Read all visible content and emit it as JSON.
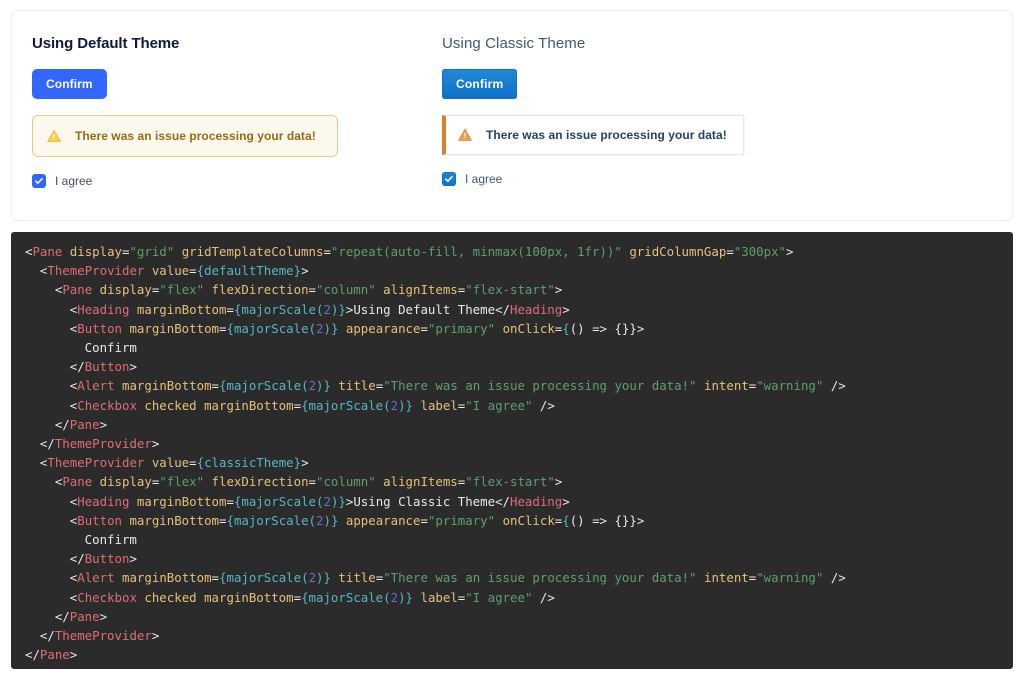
{
  "preview": {
    "columns": [
      {
        "theme_key": "default",
        "heading": "Using Default Theme",
        "button_label": "Confirm",
        "alert": {
          "title": "There was an issue processing your data!",
          "intent": "warning",
          "icon": "warning-triangle-icon"
        },
        "checkbox": {
          "label": "I agree",
          "checked": true
        }
      },
      {
        "theme_key": "classic",
        "heading": "Using Classic Theme",
        "button_label": "Confirm",
        "alert": {
          "title": "There was an issue processing your data!",
          "intent": "warning",
          "icon": "warning-triangle-icon"
        },
        "checkbox": {
          "label": "I agree",
          "checked": true
        }
      }
    ]
  },
  "colors": {
    "default_primary": "#3366FF",
    "classic_primary": "#1070CA",
    "warning_default_border": "#EBC884",
    "warning_default_bg": "#FDF8EE",
    "warning_default_text": "#996A13",
    "warning_classic_bar": "#D9822B",
    "warning_classic_text": "#234361",
    "code_background": "#2B2B2B",
    "panel_border": "#EDEFF5"
  },
  "code": {
    "language": "jsx",
    "lines": [
      [
        {
          "t": "punct",
          "v": "<"
        },
        {
          "t": "tag",
          "v": "Pane"
        },
        {
          "t": "text",
          "v": " "
        },
        {
          "t": "attr",
          "v": "display"
        },
        {
          "t": "punct",
          "v": "="
        },
        {
          "t": "string",
          "v": "\"grid\""
        },
        {
          "t": "text",
          "v": " "
        },
        {
          "t": "attr",
          "v": "gridTemplateColumns"
        },
        {
          "t": "punct",
          "v": "="
        },
        {
          "t": "string",
          "v": "\"repeat(auto-fill, minmax(100px, 1fr))\""
        },
        {
          "t": "text",
          "v": " "
        },
        {
          "t": "attr",
          "v": "gridColumnGap"
        },
        {
          "t": "punct",
          "v": "="
        },
        {
          "t": "string",
          "v": "\"300px\""
        },
        {
          "t": "punct",
          "v": ">"
        }
      ],
      [
        {
          "t": "text",
          "v": "  "
        },
        {
          "t": "punct",
          "v": "<"
        },
        {
          "t": "tag",
          "v": "ThemeProvider"
        },
        {
          "t": "text",
          "v": " "
        },
        {
          "t": "attr",
          "v": "value"
        },
        {
          "t": "punct",
          "v": "="
        },
        {
          "t": "brace",
          "v": "{"
        },
        {
          "t": "fn",
          "v": "defaultTheme"
        },
        {
          "t": "brace",
          "v": "}"
        },
        {
          "t": "punct",
          "v": ">"
        }
      ],
      [
        {
          "t": "text",
          "v": "    "
        },
        {
          "t": "punct",
          "v": "<"
        },
        {
          "t": "tag",
          "v": "Pane"
        },
        {
          "t": "text",
          "v": " "
        },
        {
          "t": "attr",
          "v": "display"
        },
        {
          "t": "punct",
          "v": "="
        },
        {
          "t": "string",
          "v": "\"flex\""
        },
        {
          "t": "text",
          "v": " "
        },
        {
          "t": "attr",
          "v": "flexDirection"
        },
        {
          "t": "punct",
          "v": "="
        },
        {
          "t": "string",
          "v": "\"column\""
        },
        {
          "t": "text",
          "v": " "
        },
        {
          "t": "attr",
          "v": "alignItems"
        },
        {
          "t": "punct",
          "v": "="
        },
        {
          "t": "string",
          "v": "\"flex-start\""
        },
        {
          "t": "punct",
          "v": ">"
        }
      ],
      [
        {
          "t": "text",
          "v": "      "
        },
        {
          "t": "punct",
          "v": "<"
        },
        {
          "t": "tag",
          "v": "Heading"
        },
        {
          "t": "text",
          "v": " "
        },
        {
          "t": "attr",
          "v": "marginBottom"
        },
        {
          "t": "punct",
          "v": "="
        },
        {
          "t": "brace",
          "v": "{"
        },
        {
          "t": "fn",
          "v": "majorScale"
        },
        {
          "t": "brace",
          "v": "("
        },
        {
          "t": "num",
          "v": "2"
        },
        {
          "t": "brace",
          "v": ")}"
        },
        {
          "t": "punct",
          "v": ">"
        },
        {
          "t": "text",
          "v": "Using Default Theme"
        },
        {
          "t": "punct",
          "v": "</"
        },
        {
          "t": "tag",
          "v": "Heading"
        },
        {
          "t": "punct",
          "v": ">"
        }
      ],
      [
        {
          "t": "text",
          "v": "      "
        },
        {
          "t": "punct",
          "v": "<"
        },
        {
          "t": "tag",
          "v": "Button"
        },
        {
          "t": "text",
          "v": " "
        },
        {
          "t": "attr",
          "v": "marginBottom"
        },
        {
          "t": "punct",
          "v": "="
        },
        {
          "t": "brace",
          "v": "{"
        },
        {
          "t": "fn",
          "v": "majorScale"
        },
        {
          "t": "brace",
          "v": "("
        },
        {
          "t": "num",
          "v": "2"
        },
        {
          "t": "brace",
          "v": ")}"
        },
        {
          "t": "text",
          "v": " "
        },
        {
          "t": "attr",
          "v": "appearance"
        },
        {
          "t": "punct",
          "v": "="
        },
        {
          "t": "string",
          "v": "\"primary\""
        },
        {
          "t": "text",
          "v": " "
        },
        {
          "t": "attr",
          "v": "onClick"
        },
        {
          "t": "punct",
          "v": "="
        },
        {
          "t": "brace",
          "v": "{"
        },
        {
          "t": "punct",
          "v": "() => {}}"
        },
        {
          "t": "punct",
          "v": ">"
        }
      ],
      [
        {
          "t": "text",
          "v": "        Confirm"
        }
      ],
      [
        {
          "t": "text",
          "v": "      "
        },
        {
          "t": "punct",
          "v": "</"
        },
        {
          "t": "tag",
          "v": "Button"
        },
        {
          "t": "punct",
          "v": ">"
        }
      ],
      [
        {
          "t": "text",
          "v": "      "
        },
        {
          "t": "punct",
          "v": "<"
        },
        {
          "t": "tag",
          "v": "Alert"
        },
        {
          "t": "text",
          "v": " "
        },
        {
          "t": "attr",
          "v": "marginBottom"
        },
        {
          "t": "punct",
          "v": "="
        },
        {
          "t": "brace",
          "v": "{"
        },
        {
          "t": "fn",
          "v": "majorScale"
        },
        {
          "t": "brace",
          "v": "("
        },
        {
          "t": "num",
          "v": "2"
        },
        {
          "t": "brace",
          "v": ")}"
        },
        {
          "t": "text",
          "v": " "
        },
        {
          "t": "attr",
          "v": "title"
        },
        {
          "t": "punct",
          "v": "="
        },
        {
          "t": "string",
          "v": "\"There was an issue processing your data!\""
        },
        {
          "t": "text",
          "v": " "
        },
        {
          "t": "attr",
          "v": "intent"
        },
        {
          "t": "punct",
          "v": "="
        },
        {
          "t": "string",
          "v": "\"warning\""
        },
        {
          "t": "text",
          "v": " "
        },
        {
          "t": "punct",
          "v": "/>"
        }
      ],
      [
        {
          "t": "text",
          "v": "      "
        },
        {
          "t": "punct",
          "v": "<"
        },
        {
          "t": "tag",
          "v": "Checkbox"
        },
        {
          "t": "text",
          "v": " "
        },
        {
          "t": "attr",
          "v": "checked"
        },
        {
          "t": "text",
          "v": " "
        },
        {
          "t": "attr",
          "v": "marginBottom"
        },
        {
          "t": "punct",
          "v": "="
        },
        {
          "t": "brace",
          "v": "{"
        },
        {
          "t": "fn",
          "v": "majorScale"
        },
        {
          "t": "brace",
          "v": "("
        },
        {
          "t": "num",
          "v": "2"
        },
        {
          "t": "brace",
          "v": ")}"
        },
        {
          "t": "text",
          "v": " "
        },
        {
          "t": "attr",
          "v": "label"
        },
        {
          "t": "punct",
          "v": "="
        },
        {
          "t": "string",
          "v": "\"I agree\""
        },
        {
          "t": "text",
          "v": " "
        },
        {
          "t": "punct",
          "v": "/>"
        }
      ],
      [
        {
          "t": "text",
          "v": "    "
        },
        {
          "t": "punct",
          "v": "</"
        },
        {
          "t": "tag",
          "v": "Pane"
        },
        {
          "t": "punct",
          "v": ">"
        }
      ],
      [
        {
          "t": "text",
          "v": "  "
        },
        {
          "t": "punct",
          "v": "</"
        },
        {
          "t": "tag",
          "v": "ThemeProvider"
        },
        {
          "t": "punct",
          "v": ">"
        }
      ],
      [
        {
          "t": "text",
          "v": "  "
        },
        {
          "t": "punct",
          "v": "<"
        },
        {
          "t": "tag",
          "v": "ThemeProvider"
        },
        {
          "t": "text",
          "v": " "
        },
        {
          "t": "attr",
          "v": "value"
        },
        {
          "t": "punct",
          "v": "="
        },
        {
          "t": "brace",
          "v": "{"
        },
        {
          "t": "fn",
          "v": "classicTheme"
        },
        {
          "t": "brace",
          "v": "}"
        },
        {
          "t": "punct",
          "v": ">"
        }
      ],
      [
        {
          "t": "text",
          "v": "    "
        },
        {
          "t": "punct",
          "v": "<"
        },
        {
          "t": "tag",
          "v": "Pane"
        },
        {
          "t": "text",
          "v": " "
        },
        {
          "t": "attr",
          "v": "display"
        },
        {
          "t": "punct",
          "v": "="
        },
        {
          "t": "string",
          "v": "\"flex\""
        },
        {
          "t": "text",
          "v": " "
        },
        {
          "t": "attr",
          "v": "flexDirection"
        },
        {
          "t": "punct",
          "v": "="
        },
        {
          "t": "string",
          "v": "\"column\""
        },
        {
          "t": "text",
          "v": " "
        },
        {
          "t": "attr",
          "v": "alignItems"
        },
        {
          "t": "punct",
          "v": "="
        },
        {
          "t": "string",
          "v": "\"flex-start\""
        },
        {
          "t": "punct",
          "v": ">"
        }
      ],
      [
        {
          "t": "text",
          "v": "      "
        },
        {
          "t": "punct",
          "v": "<"
        },
        {
          "t": "tag",
          "v": "Heading"
        },
        {
          "t": "text",
          "v": " "
        },
        {
          "t": "attr",
          "v": "marginBottom"
        },
        {
          "t": "punct",
          "v": "="
        },
        {
          "t": "brace",
          "v": "{"
        },
        {
          "t": "fn",
          "v": "majorScale"
        },
        {
          "t": "brace",
          "v": "("
        },
        {
          "t": "num",
          "v": "2"
        },
        {
          "t": "brace",
          "v": ")}"
        },
        {
          "t": "punct",
          "v": ">"
        },
        {
          "t": "text",
          "v": "Using Classic Theme"
        },
        {
          "t": "punct",
          "v": "</"
        },
        {
          "t": "tag",
          "v": "Heading"
        },
        {
          "t": "punct",
          "v": ">"
        }
      ],
      [
        {
          "t": "text",
          "v": "      "
        },
        {
          "t": "punct",
          "v": "<"
        },
        {
          "t": "tag",
          "v": "Button"
        },
        {
          "t": "text",
          "v": " "
        },
        {
          "t": "attr",
          "v": "marginBottom"
        },
        {
          "t": "punct",
          "v": "="
        },
        {
          "t": "brace",
          "v": "{"
        },
        {
          "t": "fn",
          "v": "majorScale"
        },
        {
          "t": "brace",
          "v": "("
        },
        {
          "t": "num",
          "v": "2"
        },
        {
          "t": "brace",
          "v": ")}"
        },
        {
          "t": "text",
          "v": " "
        },
        {
          "t": "attr",
          "v": "appearance"
        },
        {
          "t": "punct",
          "v": "="
        },
        {
          "t": "string",
          "v": "\"primary\""
        },
        {
          "t": "text",
          "v": " "
        },
        {
          "t": "attr",
          "v": "onClick"
        },
        {
          "t": "punct",
          "v": "="
        },
        {
          "t": "brace",
          "v": "{"
        },
        {
          "t": "punct",
          "v": "() => {}}"
        },
        {
          "t": "punct",
          "v": ">"
        }
      ],
      [
        {
          "t": "text",
          "v": "        Confirm"
        }
      ],
      [
        {
          "t": "text",
          "v": "      "
        },
        {
          "t": "punct",
          "v": "</"
        },
        {
          "t": "tag",
          "v": "Button"
        },
        {
          "t": "punct",
          "v": ">"
        }
      ],
      [
        {
          "t": "text",
          "v": "      "
        },
        {
          "t": "punct",
          "v": "<"
        },
        {
          "t": "tag",
          "v": "Alert"
        },
        {
          "t": "text",
          "v": " "
        },
        {
          "t": "attr",
          "v": "marginBottom"
        },
        {
          "t": "punct",
          "v": "="
        },
        {
          "t": "brace",
          "v": "{"
        },
        {
          "t": "fn",
          "v": "majorScale"
        },
        {
          "t": "brace",
          "v": "("
        },
        {
          "t": "num",
          "v": "2"
        },
        {
          "t": "brace",
          "v": ")}"
        },
        {
          "t": "text",
          "v": " "
        },
        {
          "t": "attr",
          "v": "title"
        },
        {
          "t": "punct",
          "v": "="
        },
        {
          "t": "string",
          "v": "\"There was an issue processing your data!\""
        },
        {
          "t": "text",
          "v": " "
        },
        {
          "t": "attr",
          "v": "intent"
        },
        {
          "t": "punct",
          "v": "="
        },
        {
          "t": "string",
          "v": "\"warning\""
        },
        {
          "t": "text",
          "v": " "
        },
        {
          "t": "punct",
          "v": "/>"
        }
      ],
      [
        {
          "t": "text",
          "v": "      "
        },
        {
          "t": "punct",
          "v": "<"
        },
        {
          "t": "tag",
          "v": "Checkbox"
        },
        {
          "t": "text",
          "v": " "
        },
        {
          "t": "attr",
          "v": "checked"
        },
        {
          "t": "text",
          "v": " "
        },
        {
          "t": "attr",
          "v": "marginBottom"
        },
        {
          "t": "punct",
          "v": "="
        },
        {
          "t": "brace",
          "v": "{"
        },
        {
          "t": "fn",
          "v": "majorScale"
        },
        {
          "t": "brace",
          "v": "("
        },
        {
          "t": "num",
          "v": "2"
        },
        {
          "t": "brace",
          "v": ")}"
        },
        {
          "t": "text",
          "v": " "
        },
        {
          "t": "attr",
          "v": "label"
        },
        {
          "t": "punct",
          "v": "="
        },
        {
          "t": "string",
          "v": "\"I agree\""
        },
        {
          "t": "text",
          "v": " "
        },
        {
          "t": "punct",
          "v": "/>"
        }
      ],
      [
        {
          "t": "text",
          "v": "    "
        },
        {
          "t": "punct",
          "v": "</"
        },
        {
          "t": "tag",
          "v": "Pane"
        },
        {
          "t": "punct",
          "v": ">"
        }
      ],
      [
        {
          "t": "text",
          "v": "  "
        },
        {
          "t": "punct",
          "v": "</"
        },
        {
          "t": "tag",
          "v": "ThemeProvider"
        },
        {
          "t": "punct",
          "v": ">"
        }
      ],
      [
        {
          "t": "punct",
          "v": "</"
        },
        {
          "t": "tag",
          "v": "Pane"
        },
        {
          "t": "punct",
          "v": ">"
        }
      ]
    ]
  }
}
